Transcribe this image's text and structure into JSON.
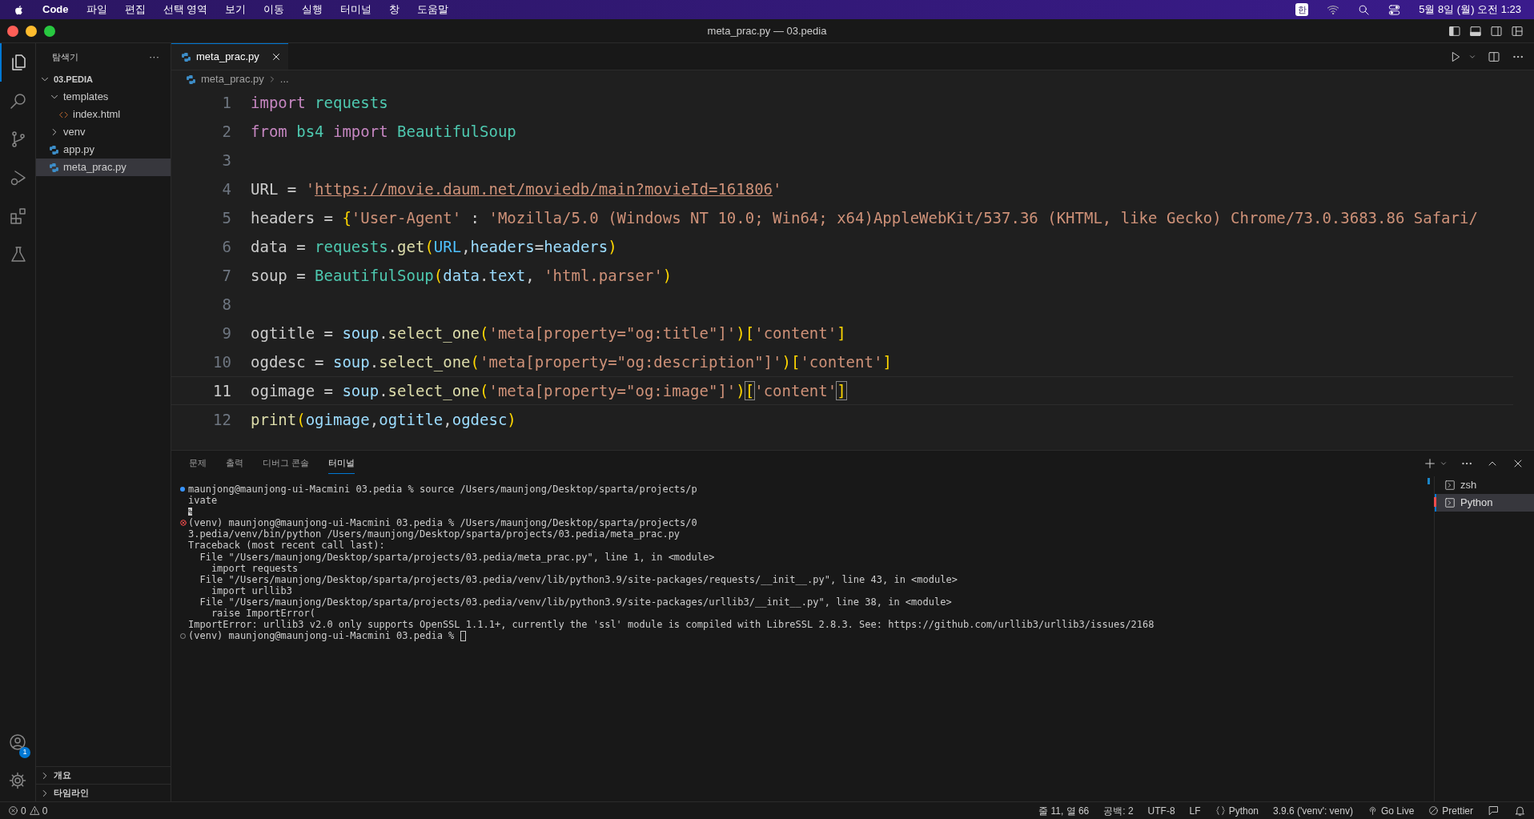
{
  "menu_bar": {
    "app": "Code",
    "menus": [
      "파일",
      "편집",
      "선택 영역",
      "보기",
      "이동",
      "실행",
      "터미널",
      "창",
      "도움말"
    ],
    "input_source": "한",
    "clock": "5월 8일 (월) 오전 1:23"
  },
  "window": {
    "title": "meta_prac.py — 03.pedia"
  },
  "activity_bar": [
    {
      "selected": true
    },
    {
      "selected": false
    },
    {
      "selected": false
    },
    {
      "selected": false
    },
    {
      "selected": false
    },
    {
      "selected": false
    }
  ],
  "account_badge": "1",
  "explorer": {
    "title": "탐색기",
    "more": "···",
    "tree": [
      {
        "label": "03.PEDIA",
        "kind": "folder",
        "expanded": true,
        "selected": false,
        "children": [
          {
            "label": "templates",
            "kind": "folder",
            "expanded": true,
            "selected": false,
            "children": [
              {
                "label": "index.html",
                "kind": "html_file",
                "selected": false
              }
            ]
          },
          {
            "label": "venv",
            "kind": "folder",
            "expanded": false,
            "selected": false
          },
          {
            "label": "app.py",
            "kind": "python_file",
            "selected": false
          },
          {
            "label": "meta_prac.py",
            "kind": "python_file",
            "selected": true
          }
        ]
      }
    ],
    "sections": [
      {
        "label": "개요",
        "expanded": false
      },
      {
        "label": "타임라인",
        "expanded": false
      }
    ]
  },
  "editor": {
    "tabs": [
      {
        "label": "meta_prac.py",
        "selected": true
      }
    ],
    "breadcrumb": [
      "meta_prac.py",
      "..."
    ],
    "lines": [
      {
        "number": "1",
        "current": false,
        "tokens": [
          {
            "text": "import ",
            "kind": "kw"
          },
          {
            "text": "requests",
            "kind": "mod"
          }
        ]
      },
      {
        "number": "2",
        "current": false,
        "tokens": [
          {
            "text": "from ",
            "kind": "kw"
          },
          {
            "text": "bs4 ",
            "kind": "mod"
          },
          {
            "text": "import ",
            "kind": "kw"
          },
          {
            "text": "BeautifulSoup",
            "kind": "mod"
          }
        ]
      },
      {
        "number": "3",
        "current": false
      },
      {
        "number": "4",
        "current": false,
        "tokens": [
          {
            "text": "URL = ",
            "kind": "plain"
          },
          {
            "text": "'",
            "kind": "str"
          },
          {
            "text": "https://movie.daum.net/moviedb/main?movieId=161806",
            "kind": "link"
          },
          {
            "text": "'",
            "kind": "str"
          }
        ]
      },
      {
        "number": "5",
        "current": false,
        "tokens": [
          {
            "text": "headers = ",
            "kind": "plain"
          },
          {
            "text": "{",
            "kind": "bracket"
          },
          {
            "text": "'User-Agent'",
            "kind": "str"
          },
          {
            "text": " : ",
            "kind": "plain"
          },
          {
            "text": "'Mozilla/5.0 (Windows NT 10.0; Win64; x64)AppleWebKit/537.36 (KHTML, like Gecko) Chrome/73.0.3683.86 Safari/",
            "kind": "str"
          }
        ]
      },
      {
        "number": "6",
        "current": false,
        "tokens": [
          {
            "text": "data = ",
            "kind": "plain"
          },
          {
            "text": "requests",
            "kind": "mod"
          },
          {
            "text": ".",
            "kind": "plain"
          },
          {
            "text": "get",
            "kind": "fn"
          },
          {
            "text": "(",
            "kind": "bracket"
          },
          {
            "text": "URL",
            "kind": "const"
          },
          {
            "text": ",",
            "kind": "plain"
          },
          {
            "text": "headers",
            "kind": "var"
          },
          {
            "text": "=",
            "kind": "plain"
          },
          {
            "text": "headers",
            "kind": "var"
          },
          {
            "text": ")",
            "kind": "bracket"
          }
        ]
      },
      {
        "number": "7",
        "current": false,
        "tokens": [
          {
            "text": "soup = ",
            "kind": "plain"
          },
          {
            "text": "BeautifulSoup",
            "kind": "mod"
          },
          {
            "text": "(",
            "kind": "bracket"
          },
          {
            "text": "data",
            "kind": "var"
          },
          {
            "text": ".",
            "kind": "plain"
          },
          {
            "text": "text",
            "kind": "var"
          },
          {
            "text": ", ",
            "kind": "plain"
          },
          {
            "text": "'html.parser'",
            "kind": "str"
          },
          {
            "text": ")",
            "kind": "bracket"
          }
        ]
      },
      {
        "number": "8",
        "current": false
      },
      {
        "number": "9",
        "current": false,
        "tokens": [
          {
            "text": "ogtitle = ",
            "kind": "plain"
          },
          {
            "text": "soup",
            "kind": "var"
          },
          {
            "text": ".",
            "kind": "plain"
          },
          {
            "text": "select_one",
            "kind": "fn"
          },
          {
            "text": "(",
            "kind": "bracket"
          },
          {
            "text": "'meta[property=\"og:title\"]'",
            "kind": "str"
          },
          {
            "text": ")",
            "kind": "bracket"
          },
          {
            "text": "[",
            "kind": "bracket"
          },
          {
            "text": "'content'",
            "kind": "str"
          },
          {
            "text": "]",
            "kind": "bracket"
          }
        ]
      },
      {
        "number": "10",
        "current": false,
        "tokens": [
          {
            "text": "ogdesc = ",
            "kind": "plain"
          },
          {
            "text": "soup",
            "kind": "var"
          },
          {
            "text": ".",
            "kind": "plain"
          },
          {
            "text": "select_one",
            "kind": "fn"
          },
          {
            "text": "(",
            "kind": "bracket"
          },
          {
            "text": "'meta[property=\"og:description\"]'",
            "kind": "str"
          },
          {
            "text": ")",
            "kind": "bracket"
          },
          {
            "text": "[",
            "kind": "bracket"
          },
          {
            "text": "'content'",
            "kind": "str"
          },
          {
            "text": "]",
            "kind": "bracket"
          }
        ]
      },
      {
        "number": "11",
        "current": true,
        "tokens": [
          {
            "text": "ogimage = ",
            "kind": "plain"
          },
          {
            "text": "soup",
            "kind": "var"
          },
          {
            "text": ".",
            "kind": "plain"
          },
          {
            "text": "select_one",
            "kind": "fn"
          },
          {
            "text": "(",
            "kind": "bracket"
          },
          {
            "text": "'meta[property=\"og:image\"]'",
            "kind": "str"
          },
          {
            "text": ")",
            "kind": "bracket"
          },
          {
            "text": "[",
            "kind": "bracket_match"
          },
          {
            "text": "'content'",
            "kind": "str"
          },
          {
            "text": "]",
            "kind": "bracket_match"
          }
        ]
      },
      {
        "number": "12",
        "current": false,
        "tokens": [
          {
            "text": "print",
            "kind": "fn"
          },
          {
            "text": "(",
            "kind": "bracket"
          },
          {
            "text": "ogimage",
            "kind": "var"
          },
          {
            "text": ",",
            "kind": "plain"
          },
          {
            "text": "ogtitle",
            "kind": "var"
          },
          {
            "text": ",",
            "kind": "plain"
          },
          {
            "text": "ogdesc",
            "kind": "var"
          },
          {
            "text": ")",
            "kind": "bracket"
          }
        ]
      }
    ]
  },
  "panel": {
    "tabs": [
      {
        "label": "문제",
        "selected": false
      },
      {
        "label": "출력",
        "selected": false
      },
      {
        "label": "디버그 콘솔",
        "selected": false
      },
      {
        "label": "터미널",
        "selected": true
      }
    ],
    "terminal_lines": [
      {
        "kind": "success",
        "text": "maunjong@maunjong-ui-Macmini 03.pedia % source /Users/maunjong/Desktop/sparta/projects/p"
      },
      {
        "kind": "output",
        "text": "ivate"
      },
      {
        "kind": "inverse",
        "text": "%"
      },
      {
        "kind": "error",
        "text": "(venv) maunjong@maunjong-ui-Macmini 03.pedia % /Users/maunjong/Desktop/sparta/projects/0"
      },
      {
        "kind": "output",
        "text": "3.pedia/venv/bin/python /Users/maunjong/Desktop/sparta/projects/03.pedia/meta_prac.py"
      },
      {
        "kind": "output",
        "text": "Traceback (most recent call last):"
      },
      {
        "kind": "output",
        "text": "  File \"/Users/maunjong/Desktop/sparta/projects/03.pedia/meta_prac.py\", line 1, in <module>"
      },
      {
        "kind": "output",
        "text": "    import requests"
      },
      {
        "kind": "output",
        "text": "  File \"/Users/maunjong/Desktop/sparta/projects/03.pedia/venv/lib/python3.9/site-packages/requests/__init__.py\", line 43, in <module>"
      },
      {
        "kind": "output",
        "text": "    import urllib3"
      },
      {
        "kind": "output",
        "text": "  File \"/Users/maunjong/Desktop/sparta/projects/03.pedia/venv/lib/python3.9/site-packages/urllib3/__init__.py\", line 38, in <module>"
      },
      {
        "kind": "output",
        "text": "    raise ImportError("
      },
      {
        "kind": "output",
        "text": "ImportError: urllib3 v2.0 only supports OpenSSL 1.1.1+, currently the 'ssl' module is compiled with LibreSSL 2.8.3. See: https://github.com/urllib3/urllib3/issues/2168"
      },
      {
        "kind": "prompt",
        "text": "(venv) maunjong@maunjong-ui-Macmini 03.pedia % "
      }
    ],
    "terminals": [
      {
        "label": "zsh",
        "selected": false
      },
      {
        "label": "Python",
        "selected": true
      }
    ]
  },
  "status_bar": {
    "errors": "0",
    "warnings": "0",
    "items": [
      {
        "text": "줄 11, 열 66",
        "kind": "text"
      },
      {
        "text": "공백: 2",
        "kind": "text"
      },
      {
        "text": "UTF-8",
        "kind": "text"
      },
      {
        "text": "LF",
        "kind": "text"
      },
      {
        "text": "Python",
        "kind": "language"
      },
      {
        "text": "3.9.6 ('venv': venv)",
        "kind": "text"
      },
      {
        "text": "Go Live",
        "kind": "live"
      },
      {
        "text": "Prettier",
        "kind": "formatter"
      }
    ]
  }
}
